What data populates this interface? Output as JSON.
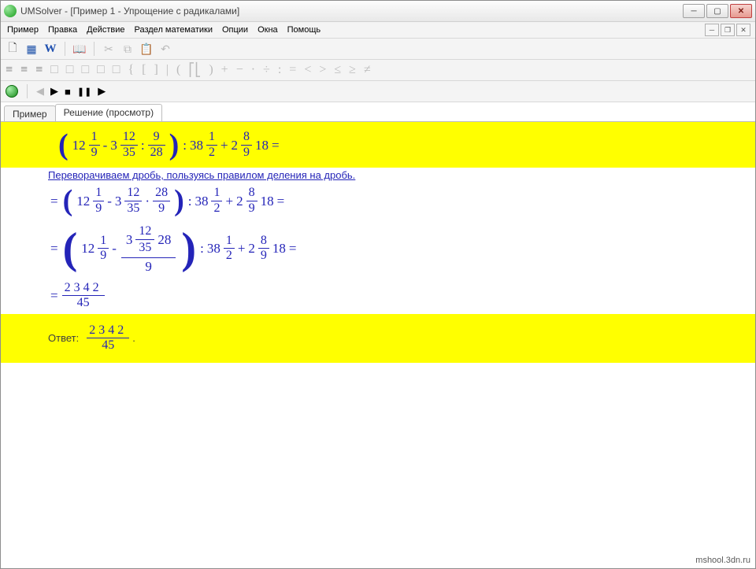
{
  "window": {
    "title": "UMSolver - [Пример 1 - Упрощение с радикалами]"
  },
  "menu": {
    "item0": "Пример",
    "item1": "Правка",
    "item2": "Действие",
    "item3": "Раздел математики",
    "item4": "Опции",
    "item5": "Окна",
    "item6": "Помощь"
  },
  "toolbar": {
    "new_icon": "🗋",
    "grid_icon": "▦",
    "w_label": "W",
    "copybook_icon": "📖",
    "cut_icon": "✂",
    "copy_icon": "⧉",
    "paste_icon": "📋",
    "undo_icon": "↶"
  },
  "symbols": {
    "s0": "≡",
    "s1": "≡",
    "s2": "≡",
    "s3": "□",
    "s4": "□",
    "s5": "□",
    "s6": "□",
    "s7": "□",
    "s8": "{",
    "s9": "[",
    "s10": "]",
    "s11": "|",
    "s12": "(",
    "s13": "⎡⎣",
    "s14": ")",
    "s15": "+",
    "s16": "−",
    "s17": "·",
    "s18": "÷",
    "s19": ":",
    "s20": "=",
    "s21": "<",
    "s22": ">",
    "s23": "≤",
    "s24": "≥",
    "s25": "≠"
  },
  "play": {
    "prev": "◀",
    "play": "▶",
    "stop": "■",
    "pause": "❚❚",
    "next": "▶"
  },
  "tabs": {
    "tab1": "Пример",
    "tab2": "Решение (просмотр)"
  },
  "expr": {
    "twelve": "12",
    "one": "1",
    "nine": "9",
    "minus": "-",
    "three": "3",
    "thirtyfive": "35",
    "colon": ":",
    "twentyeight": "28",
    "thirtyeight": "38",
    "two": "2",
    "plus": "+",
    "eight": "8",
    "eighteen": "18",
    "equals": "=",
    "val2342": "2342",
    "fortyfive": "45"
  },
  "notes": {
    "step1": "Переворачиваем дробь, пользуясь правилом деления на дробь."
  },
  "answer": {
    "label": "Ответ:",
    "dot": "."
  },
  "watermark": "mshool.3dn.ru"
}
